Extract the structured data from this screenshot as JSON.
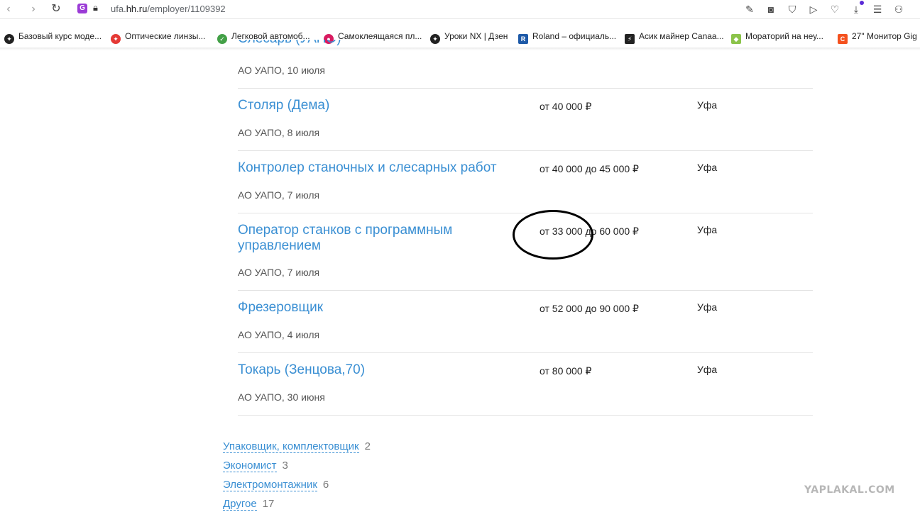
{
  "browser": {
    "url_prefix": "ufa.",
    "url_domain": "hh.ru",
    "url_path": "/employer/1109392",
    "ext_badge": "G"
  },
  "bookmarks": [
    {
      "label": "Базовый курс моде...",
      "icon_color": "#222222",
      "icon_text": "✦"
    },
    {
      "label": "Оптические линзы...",
      "icon_color": "#e53935",
      "icon_text": "✦"
    },
    {
      "label": "Легковой автомоб...",
      "icon_color": "#43a047",
      "icon_text": "✓"
    },
    {
      "label": "Самоклеящаяся пл...",
      "icon_color": "#d81b60",
      "icon_text": "●"
    },
    {
      "label": "Уроки NX | Дзен",
      "icon_color": "#222222",
      "icon_text": "✦"
    },
    {
      "label": "Roland – официаль...",
      "icon_color": "#1e5aa8",
      "icon_text": "R"
    },
    {
      "label": "Асик майнер Canaa...",
      "icon_color": "#222222",
      "icon_text": "⚡"
    },
    {
      "label": "Мораторий на неу...",
      "icon_color": "#8bc34a",
      "icon_text": "◆"
    },
    {
      "label": "27\" Монитор Gig",
      "icon_color": "#f4511e",
      "icon_text": "C"
    }
  ],
  "partial_vacancy": {
    "title_tail": "Слесарь (УАПО)",
    "subtitle": "АО УАПО, 10 июля"
  },
  "vacancies": [
    {
      "title": "Столяр (Дема)",
      "salary": "от 40 000 ₽",
      "city": "Уфа",
      "subtitle": "АО УАПО, 8 июля"
    },
    {
      "title": "Контролер станочных и слесарных работ",
      "salary": "от 40 000 до 45 000 ₽",
      "city": "Уфа",
      "subtitle": "АО УАПО, 7 июля"
    },
    {
      "title": "Оператор станков с программным управлением",
      "salary": "от 33 000 до 60 000 ₽",
      "city": "Уфа",
      "subtitle": "АО УАПО, 7 июля"
    },
    {
      "title": "Фрезеровщик",
      "salary": "от 52 000 до 90 000 ₽",
      "city": "Уфа",
      "subtitle": "АО УАПО, 4 июля"
    },
    {
      "title": "Токарь (Зенцова,70)",
      "salary": "от 80 000 ₽",
      "city": "Уфа",
      "subtitle": "АО УАПО, 30 июня"
    }
  ],
  "categories": [
    {
      "label": "Упаковщик, комплектовщик",
      "count": "2"
    },
    {
      "label": "Экономист",
      "count": "3"
    },
    {
      "label": "Электромонтажник",
      "count": "6"
    },
    {
      "label": "Другое",
      "count": "17"
    }
  ],
  "watermark": "YAPLAKAL.COM"
}
